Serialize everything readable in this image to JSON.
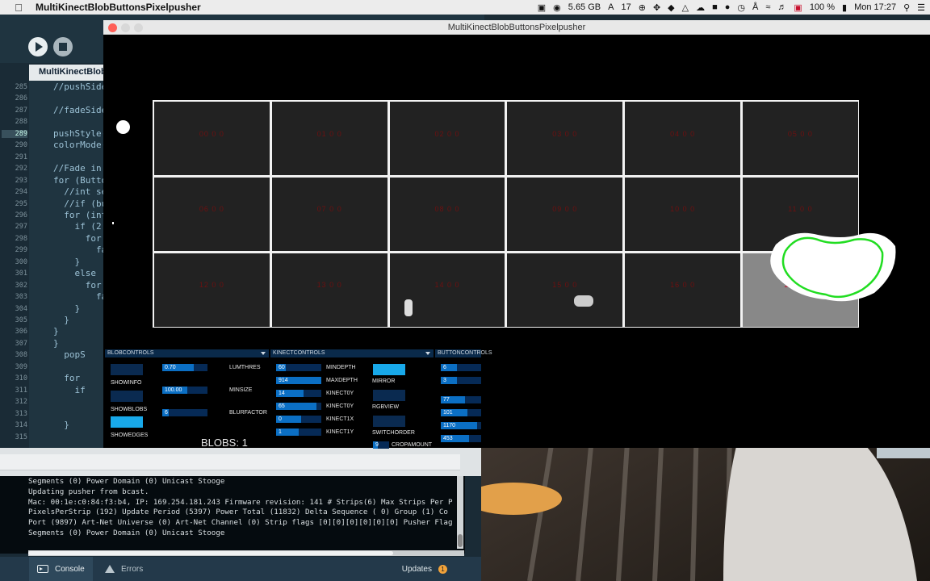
{
  "menubar": {
    "app_name": "MultiKinectBlobButtonsPixelpusher",
    "memory": "5.65 GB",
    "adobe_count": "17",
    "battery": "100 %",
    "clock": "Mon 17:27"
  },
  "ide": {
    "tab_label": "MultiKinectBlobButtonsPixelpusher",
    "line_numbers": [
      "285",
      "286",
      "287",
      "288",
      "289",
      "290",
      "291",
      "292",
      "293",
      "294",
      "295",
      "296",
      "297",
      "298",
      "299",
      "300",
      "301",
      "302",
      "303",
      "304",
      "305",
      "306",
      "307",
      "308",
      "309",
      "310",
      "311",
      "312",
      "313",
      "314",
      "315"
    ],
    "highlighted_line": "289",
    "code_lines": [
      {
        "ln": "285",
        "text": "//pushSide"
      },
      {
        "ln": "287",
        "text": "//fadeSide"
      },
      {
        "ln": "289",
        "text": "pushStyle("
      },
      {
        "ln": "290",
        "text": "colorMode("
      },
      {
        "ln": "292",
        "text": "//Fade in"
      },
      {
        "ln": "293",
        "text": "for (Butto"
      },
      {
        "ln": "294",
        "text": "  //int se"
      },
      {
        "ln": "295",
        "text": "  //if (bu"
      },
      {
        "ln": "296",
        "text": "  for (int"
      },
      {
        "ln": "297",
        "text": "    if (2"
      },
      {
        "ln": "298",
        "text": "      for"
      },
      {
        "ln": "299",
        "text": "        fa"
      },
      {
        "ln": "300",
        "text": "    }"
      },
      {
        "ln": "301",
        "text": "    else"
      },
      {
        "ln": "302",
        "text": "      for"
      },
      {
        "ln": "303",
        "text": "        fa"
      },
      {
        "ln": "304",
        "text": "    }"
      },
      {
        "ln": "305",
        "text": "  }"
      },
      {
        "ln": "306",
        "text": "}"
      },
      {
        "ln": "307",
        "text": "}"
      },
      {
        "ln": "308",
        "text": "  popS"
      },
      {
        "ln": "310",
        "text": "  for"
      },
      {
        "ln": "311",
        "text": "    if"
      },
      {
        "ln": "314",
        "text": "  }"
      }
    ]
  },
  "console": {
    "lines": [
      "Segments (0) Power Domain (0) Unicast Stooge",
      "Updating pusher from bcast.",
      "Mac: 00:1e:c0:84:f3:b4, IP: 169.254.181.243 Firmware revision: 141 # Strips(6) Max Strips Per P",
      "PixelsPerStrip (192) Update Period (5397) Power Total (11832) Delta Sequence ( 0) Group (1) Co",
      "Port (9897) Art-Net Universe (0) Art-Net Channel (0) Strip flags [0][0][0][0][0][0] Pusher Flag",
      "Segments (0) Power Domain (0) Unicast Stooge"
    ],
    "tab_console": "Console",
    "tab_errors": "Errors",
    "updates_label": "Updates",
    "updates_count": "1"
  },
  "sketch": {
    "window_title": "MultiKinectBlobButtonsPixelpusher",
    "grid": {
      "rows": [
        [
          "00 0 0",
          "01 0 0",
          "02 0 0",
          "03 0 0",
          "04 0 0",
          "05 0 0"
        ],
        [
          "06 0 0",
          "07 0 0",
          "08 0 0",
          "09 0 0",
          "10 0 0",
          "11 0 0"
        ],
        [
          "12 0 0",
          "13 0 0",
          "14 0 0",
          "15 0 0",
          "16 0 0",
          "17 5 2 0"
        ]
      ],
      "lit_cell": "17 5 2 0"
    },
    "blob_controls": {
      "title": "BLOBCONTROLS",
      "toggles": [
        {
          "label": "SHOWINFO",
          "on": false
        },
        {
          "label": "SHOWBLOBS",
          "on": false
        },
        {
          "label": "SHOWEDGES",
          "on": true
        }
      ],
      "sliders": [
        {
          "label": "LUMTHRES",
          "value": "0.70",
          "fraction": 0.7
        },
        {
          "label": "MINSIZE",
          "value": "100.00",
          "fraction": 0.55
        },
        {
          "label": "BLURFACTOR",
          "value": "6",
          "fraction": 0.15
        }
      ],
      "blobs_text": "BLOBS: 1"
    },
    "kinect_controls": {
      "title": "KINECTCONTROLS",
      "sliders": [
        {
          "label": "MINDEPTH",
          "value": "60",
          "fraction": 0.22
        },
        {
          "label": "MAXDEPTH",
          "value": "914",
          "fraction": 1.0
        },
        {
          "label": "KINECT0Y",
          "value": "14",
          "fraction": 0.6
        },
        {
          "label": "KINECT0Y",
          "value": "65",
          "fraction": 0.9
        },
        {
          "label": "KINECT1X",
          "value": "0",
          "fraction": 0.55
        },
        {
          "label": "KINECT1Y",
          "value": "1",
          "fraction": 0.5
        }
      ],
      "toggles": [
        {
          "label": "MIRROR",
          "on": true
        },
        {
          "label": "RGBVIEW",
          "on": false
        },
        {
          "label": "SWITCHORDER",
          "on": false
        }
      ],
      "crop_label": "CROPAMOUNT",
      "crop_value": "9"
    },
    "button_controls": {
      "title": "BUTTONCONTROLS",
      "sliders": [
        {
          "value": "6",
          "fraction": 0.4
        },
        {
          "value": "3",
          "fraction": 0.4
        },
        {
          "value": "77",
          "fraction": 0.6
        },
        {
          "value": "101",
          "fraction": 0.65
        },
        {
          "value": "1170",
          "fraction": 0.9
        },
        {
          "value": "453",
          "fraction": 0.7
        }
      ]
    }
  }
}
